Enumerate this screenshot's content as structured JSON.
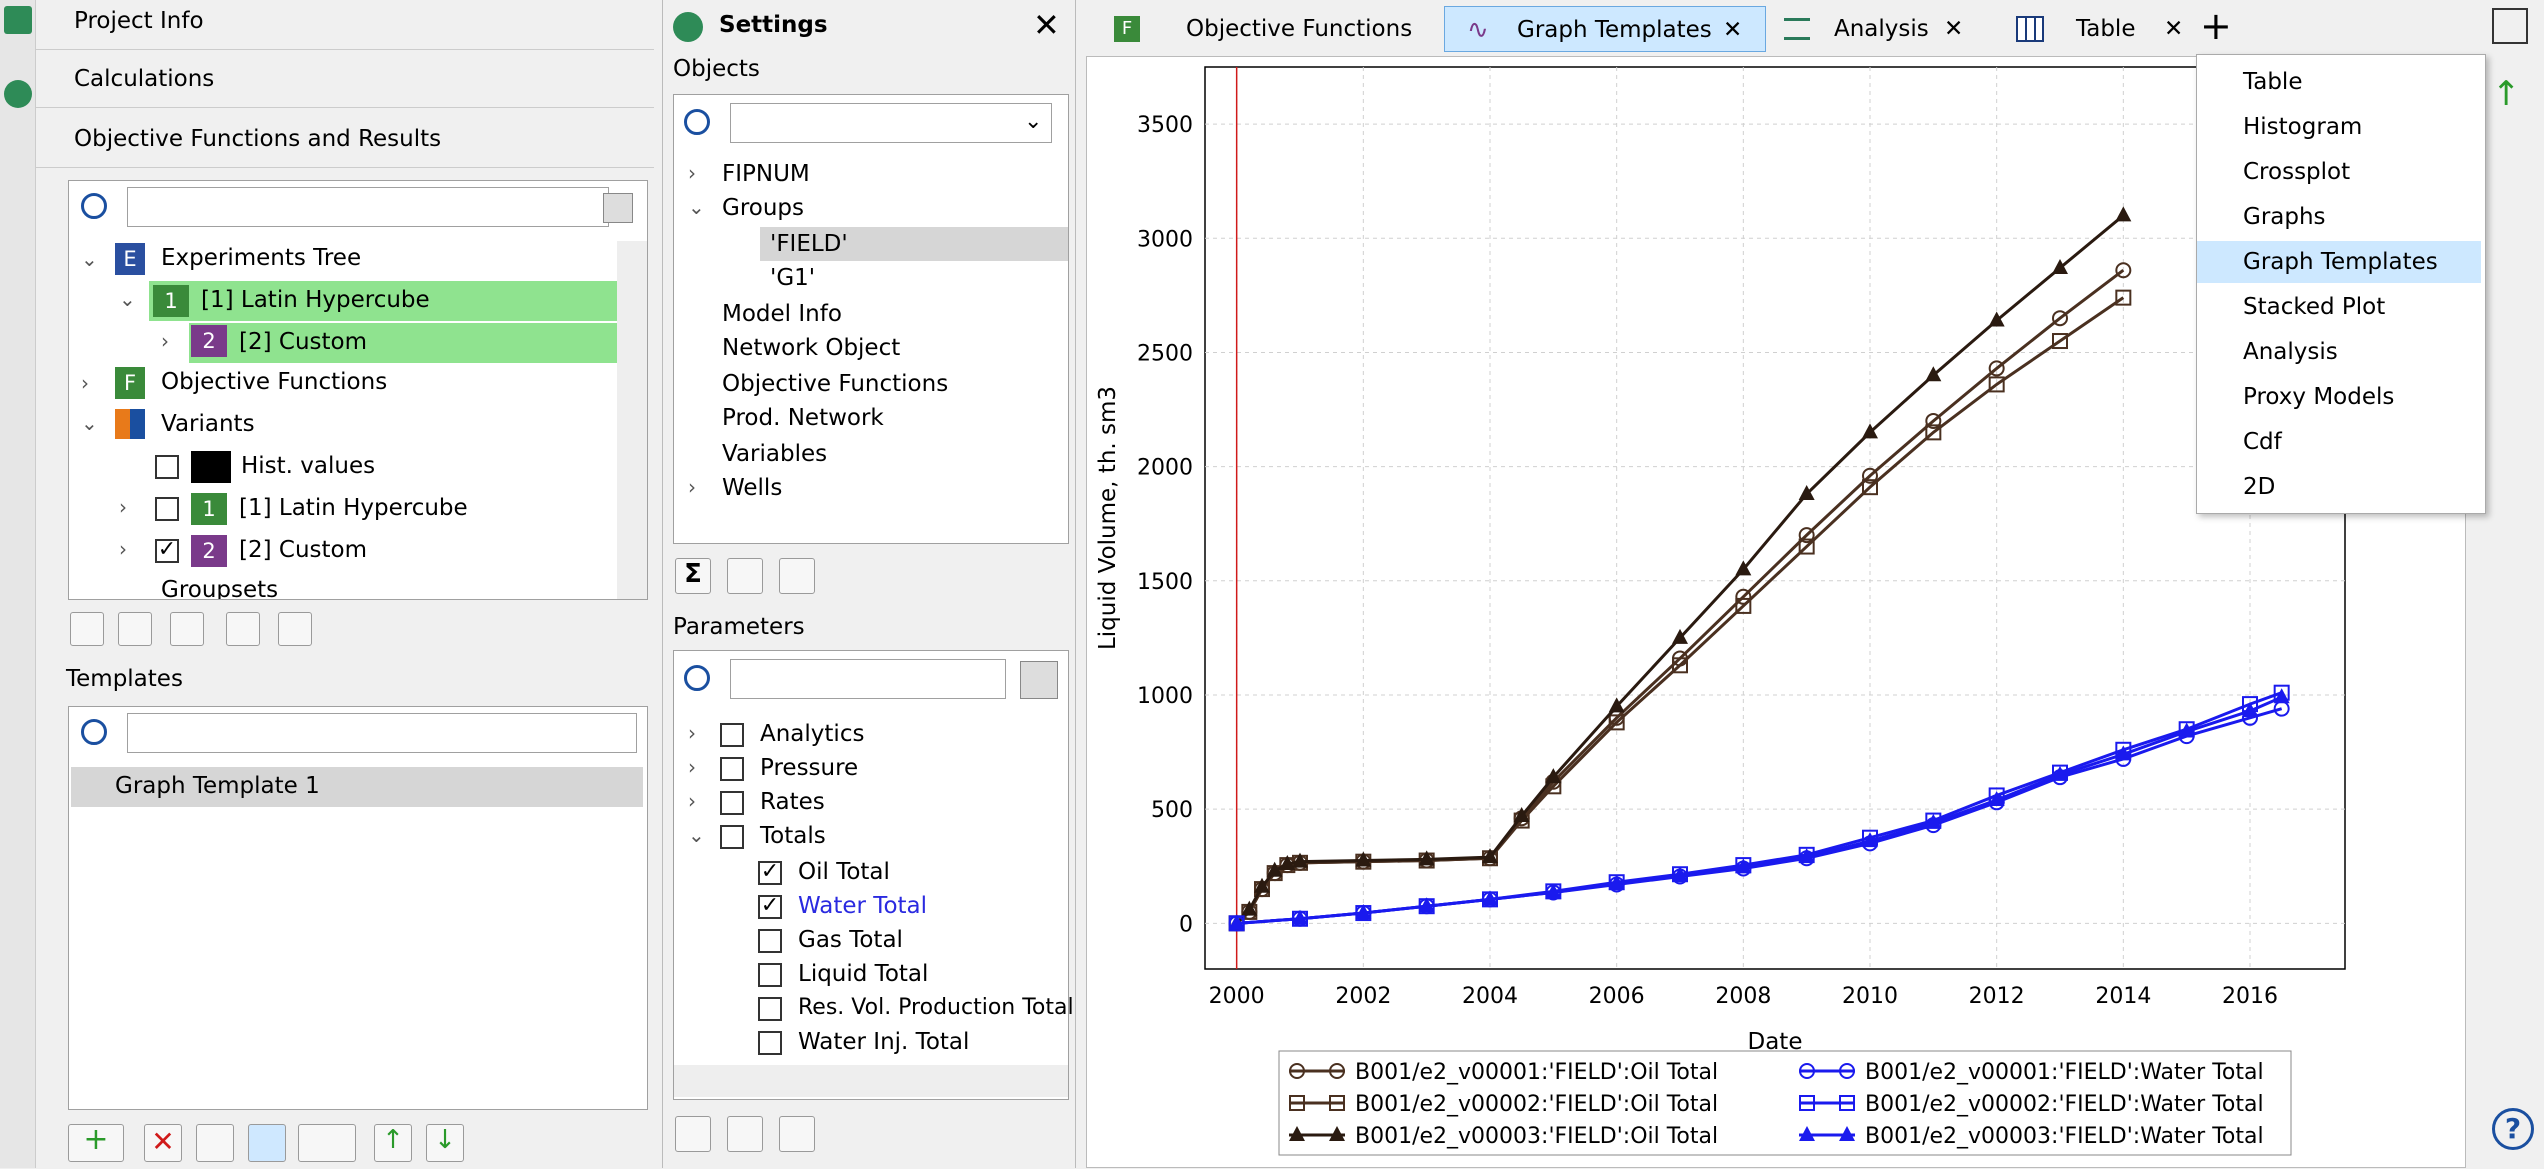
{
  "left": {
    "nav": [
      "Project Info",
      "Calculations",
      "Objective Functions and Results"
    ],
    "exp_tree": [
      {
        "label": "Experiments Tree",
        "badge": "E",
        "color": "#2a4fa0"
      },
      {
        "label": "[1] Latin Hypercube",
        "badge": "1",
        "color": "#3a8a3a"
      },
      {
        "label": "[2] Custom",
        "badge": "2",
        "color": "#7a3a8a"
      },
      {
        "label": "Objective Functions",
        "badge": "F",
        "color": "#3a8a3a"
      },
      {
        "label": "Variants"
      },
      {
        "label": "Hist. values"
      },
      {
        "label": "[1] Latin Hypercube",
        "badge": "1",
        "color": "#3a8a3a"
      },
      {
        "label": "[2] Custom",
        "badge": "2",
        "color": "#7a3a8a"
      },
      {
        "label": "Groupsets"
      }
    ],
    "templates_label": "Templates",
    "template_items": [
      "Graph Template 1"
    ]
  },
  "settings": {
    "title": "Settings",
    "objects_label": "Objects",
    "objects": [
      "FIPNUM",
      "Groups",
      "'FIELD'",
      "'G1'",
      "Model Info",
      "Network Object",
      "Objective Functions",
      "Prod. Network",
      "Variables",
      "Wells"
    ],
    "parameters_label": "Parameters",
    "params": [
      "Analytics",
      "Pressure",
      "Rates",
      "Totals",
      "Oil Total",
      "Water Total",
      "Gas Total",
      "Liquid Total",
      "Res. Vol. Production Total",
      "Water Inj. Total"
    ]
  },
  "tabs": [
    "Objective Functions",
    "Graph Templates",
    "Analysis",
    "Table"
  ],
  "menu": [
    "Table",
    "Histogram",
    "Crossplot",
    "Graphs",
    "Graph Templates",
    "Stacked Plot",
    "Analysis",
    "Proxy Models",
    "Cdf",
    "2D"
  ],
  "chart_data": {
    "type": "line",
    "xlabel": "Date",
    "ylabel": "Liquid Volume, th. sm3",
    "xlim": [
      1999.5,
      2017.5
    ],
    "ylim": [
      -200,
      3750
    ],
    "xticks": [
      2000,
      2002,
      2004,
      2006,
      2008,
      2010,
      2012,
      2014,
      2016
    ],
    "yticks": [
      0,
      500,
      1000,
      1500,
      2000,
      2500,
      3000,
      3500
    ],
    "series": [
      {
        "name": "B001/e2_v00001:'FIELD':Oil Total",
        "color": "#4a3020",
        "marker": "circle",
        "x": [
          2000,
          2000.2,
          2000.4,
          2000.6,
          2000.8,
          2001,
          2002,
          2003,
          2004,
          2004.5,
          2005,
          2006,
          2007,
          2008,
          2009,
          2010,
          2011,
          2012,
          2013,
          2014
        ],
        "y": [
          0,
          50,
          150,
          220,
          255,
          265,
          270,
          275,
          285,
          460,
          620,
          900,
          1160,
          1430,
          1700,
          1960,
          2200,
          2430,
          2650,
          2860
        ]
      },
      {
        "name": "B001/e2_v00002:'FIELD':Oil Total",
        "color": "#4a3020",
        "marker": "square",
        "x": [
          2000,
          2000.2,
          2000.4,
          2000.6,
          2000.8,
          2001,
          2002,
          2003,
          2004,
          2004.5,
          2005,
          2006,
          2007,
          2008,
          2009,
          2010,
          2011,
          2012,
          2013,
          2014
        ],
        "y": [
          0,
          50,
          150,
          220,
          255,
          265,
          270,
          275,
          285,
          450,
          600,
          880,
          1130,
          1390,
          1650,
          1910,
          2150,
          2360,
          2550,
          2740
        ]
      },
      {
        "name": "B001/e2_v00003:'FIELD':Oil Total",
        "color": "#2a1a10",
        "marker": "triangle",
        "x": [
          2000,
          2000.2,
          2000.4,
          2000.6,
          2000.8,
          2001,
          2002,
          2003,
          2004,
          2004.5,
          2005,
          2006,
          2007,
          2008,
          2009,
          2010,
          2011,
          2012,
          2013,
          2014
        ],
        "y": [
          0,
          60,
          160,
          230,
          260,
          270,
          275,
          280,
          290,
          470,
          640,
          950,
          1250,
          1550,
          1880,
          2150,
          2400,
          2640,
          2870,
          3100
        ]
      },
      {
        "name": "B001/e2_v00001:'FIELD':Water Total",
        "color": "#1a1aee",
        "marker": "circle",
        "x": [
          2000,
          2001,
          2002,
          2003,
          2004,
          2005,
          2006,
          2007,
          2008,
          2009,
          2010,
          2011,
          2012,
          2013,
          2014,
          2015,
          2016,
          2016.5
        ],
        "y": [
          0,
          20,
          45,
          75,
          105,
          135,
          170,
          205,
          240,
          285,
          350,
          430,
          530,
          640,
          720,
          820,
          900,
          940
        ]
      },
      {
        "name": "B001/e2_v00002:'FIELD':Water Total",
        "color": "#1a1aee",
        "marker": "square",
        "x": [
          2000,
          2001,
          2002,
          2003,
          2004,
          2005,
          2006,
          2007,
          2008,
          2009,
          2010,
          2011,
          2012,
          2013,
          2014,
          2015,
          2016,
          2016.5
        ],
        "y": [
          0,
          20,
          45,
          75,
          105,
          140,
          180,
          215,
          255,
          300,
          375,
          450,
          560,
          660,
          760,
          850,
          960,
          1010
        ]
      },
      {
        "name": "B001/e2_v00003:'FIELD':Water Total",
        "color": "#1a1aee",
        "marker": "triangle",
        "x": [
          2000,
          2001,
          2002,
          2003,
          2004,
          2005,
          2006,
          2007,
          2008,
          2009,
          2010,
          2011,
          2012,
          2013,
          2014,
          2015,
          2016,
          2016.5
        ],
        "y": [
          0,
          20,
          45,
          75,
          105,
          135,
          175,
          210,
          245,
          290,
          360,
          440,
          540,
          650,
          740,
          840,
          930,
          990
        ]
      }
    ]
  }
}
